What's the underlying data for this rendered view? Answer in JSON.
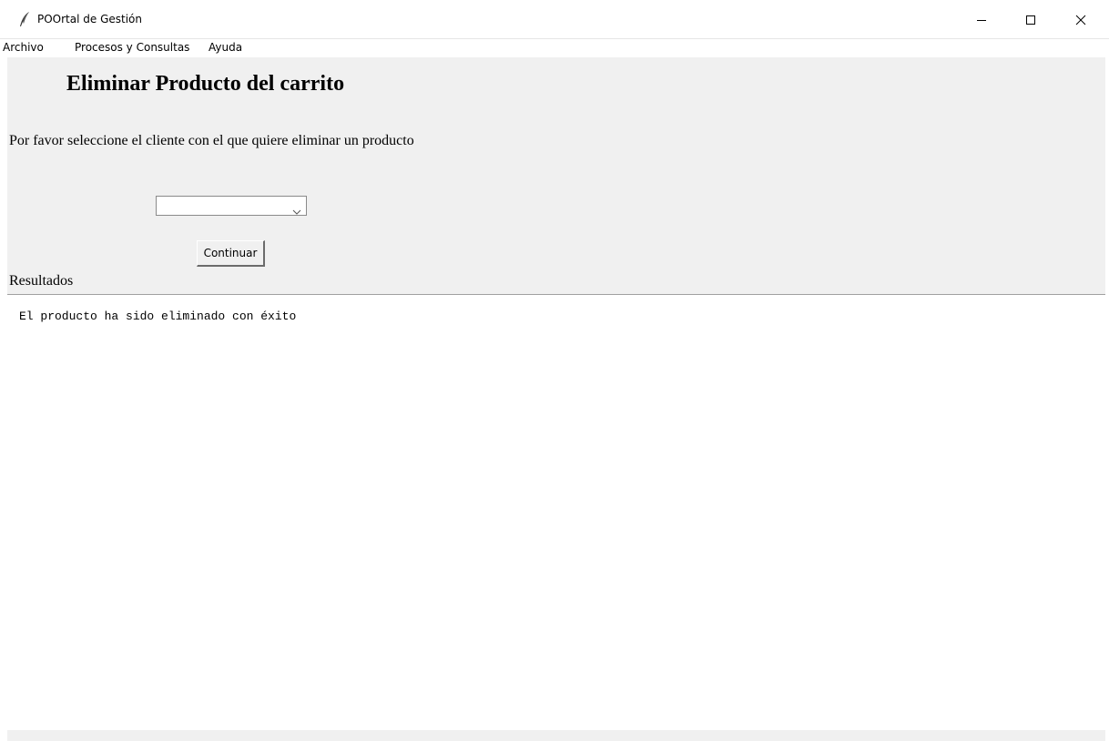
{
  "window": {
    "title": "POOrtal de Gestión",
    "icon": "feather-icon"
  },
  "menu": {
    "items": [
      {
        "label": "Archivo"
      },
      {
        "label": "Procesos y Consultas"
      },
      {
        "label": "Ayuda"
      }
    ]
  },
  "main": {
    "heading": "Eliminar Producto del carrito",
    "instruction": "Por favor seleccione el cliente con el que quiere eliminar un producto",
    "client_select_value": "",
    "continue_label": "Continuar",
    "results_label": "Resultados"
  },
  "results": {
    "text": "El producto ha sido eliminado con éxito"
  }
}
